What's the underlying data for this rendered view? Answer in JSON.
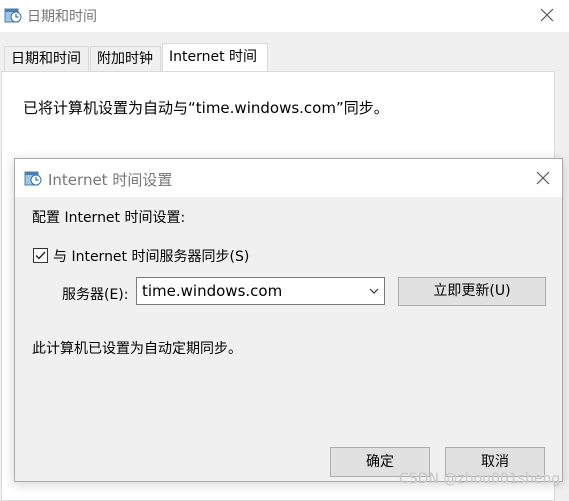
{
  "outer_window": {
    "title": "日期和时间",
    "app_icon": "clock-calendar-icon",
    "close_icon": "close-icon"
  },
  "tabs": [
    {
      "label": "日期和时间",
      "active": false
    },
    {
      "label": "附加时钟",
      "active": false
    },
    {
      "label": "Internet 时间",
      "active": true
    }
  ],
  "tab_panel": {
    "text": "已将计算机设置为自动与“time.windows.com”同步。"
  },
  "dialog": {
    "title": "Internet 时间设置",
    "icon": "clock-calendar-icon",
    "close_icon": "close-icon",
    "heading": "配置 Internet 时间设置:",
    "sync_checkbox": {
      "label": "与 Internet 时间服务器同步(S)",
      "checked": true
    },
    "server_label": "服务器(E):",
    "server_value": "time.windows.com",
    "update_button": "立即更新(U)",
    "status": "此计算机已设置为自动定期同步。",
    "ok_button": "确定",
    "cancel_button": "取消"
  },
  "watermark": "CSDN @zhou001sheng"
}
